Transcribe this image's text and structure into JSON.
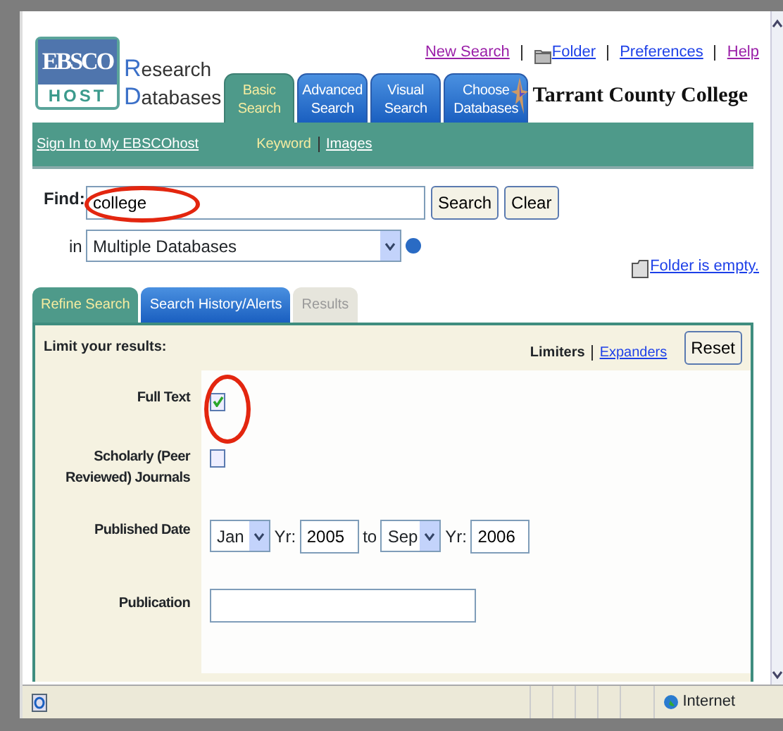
{
  "logo": {
    "line1": "EBSCO",
    "line2": "HOST"
  },
  "product_lines": [
    "Research",
    "Databases"
  ],
  "main_tabs": [
    {
      "label": "Basic Search",
      "selected": true
    },
    {
      "label": "Advanced Search",
      "selected": false
    },
    {
      "label": "Visual Search",
      "selected": false
    },
    {
      "label": "Choose Databases",
      "selected": false
    }
  ],
  "top_links": [
    {
      "label": "New Search",
      "visited": true,
      "kind": "link"
    },
    {
      "label": "Folder",
      "visited": false,
      "kind": "folder"
    },
    {
      "label": "Preferences",
      "visited": false,
      "kind": "link"
    },
    {
      "label": "Help",
      "visited": true,
      "kind": "link"
    }
  ],
  "institution": "Tarrant County College",
  "subnav": {
    "sign_in": "Sign In to My EBSCOhost",
    "modes": [
      {
        "label": "Keyword",
        "selected": true
      },
      {
        "label": "Images",
        "selected": false
      }
    ]
  },
  "find": {
    "label": "Find:",
    "value": "college",
    "circled": true,
    "buttons": [
      "Search",
      "Clear"
    ],
    "in_label": "in",
    "database": "Multiple Databases"
  },
  "folder_status": "Folder is empty.",
  "panel_tabs": [
    {
      "label": "Refine Search",
      "selected": true,
      "disabled": false
    },
    {
      "label": "Search History/Alerts",
      "selected": false,
      "disabled": false
    },
    {
      "label": "Results",
      "selected": false,
      "disabled": true
    }
  ],
  "limits": {
    "title": "Limit your results:",
    "links": [
      {
        "label": "Limiters",
        "selected": true
      },
      {
        "label": "Expanders",
        "selected": false
      }
    ],
    "reset": "Reset",
    "rows": [
      {
        "kind": "checkbox",
        "label": "Full Text",
        "checked": true,
        "circled": true
      },
      {
        "kind": "checkbox",
        "label": "Scholarly (Peer Reviewed) Journals",
        "checked": false,
        "circled": false
      },
      {
        "kind": "date",
        "label": "Published Date",
        "from_month": "Jan",
        "from_yr_label": "Yr:",
        "from_year": "2005",
        "to_label": "to",
        "to_month": "Sep",
        "to_yr_label": "Yr:",
        "to_year": "2006"
      },
      {
        "kind": "text",
        "label": "Publication"
      }
    ]
  },
  "status_bar": {
    "zone": "Internet"
  }
}
